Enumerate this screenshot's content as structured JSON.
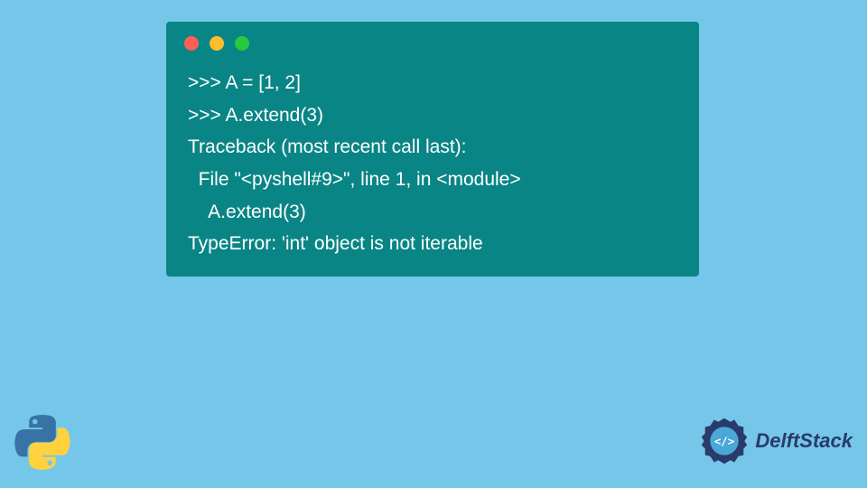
{
  "terminal": {
    "lines": [
      ">>> A = [1, 2]",
      ">>> A.extend(3)",
      "Traceback (most recent call last):",
      "  File \"<pyshell#9>\", line 1, in <module>",
      "    A.extend(3)",
      "TypeError: 'int' object is not iterable"
    ]
  },
  "branding": {
    "delft_text": "DelftStack"
  },
  "colors": {
    "background": "#74c7e8",
    "terminal_bg": "#0a8585",
    "text": "#ffffff"
  }
}
